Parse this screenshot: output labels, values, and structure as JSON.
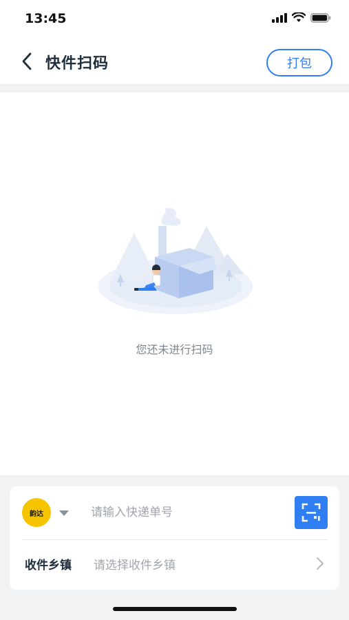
{
  "status_bar": {
    "time": "13:45",
    "icons": [
      "signal-icon",
      "wifi-icon",
      "battery-icon"
    ]
  },
  "nav": {
    "back_icon": "chevron-left-icon",
    "title": "快件扫码",
    "pack_label": "打包"
  },
  "empty_state": {
    "message": "您还未进行扫码",
    "illustration_icon": "empty-box-illustration-icon"
  },
  "scan_card": {
    "courier_logo_text": "韵达",
    "courier_logo_icon": "courier-logo-icon",
    "dropdown_icon": "caret-down-icon",
    "tracking_placeholder": "请输入快递单号",
    "tracking_value": "",
    "scan_icon": "scan-icon",
    "town_label": "收件乡镇",
    "town_placeholder": "请选择收件乡镇",
    "town_chevron_icon": "chevron-right-icon"
  },
  "colors": {
    "accent": "#2f7ff2",
    "courier_brand": "#f7c400",
    "page_bg": "#f2f3f5",
    "text_primary": "#1f2d3d",
    "text_muted": "#a0a6ae"
  }
}
